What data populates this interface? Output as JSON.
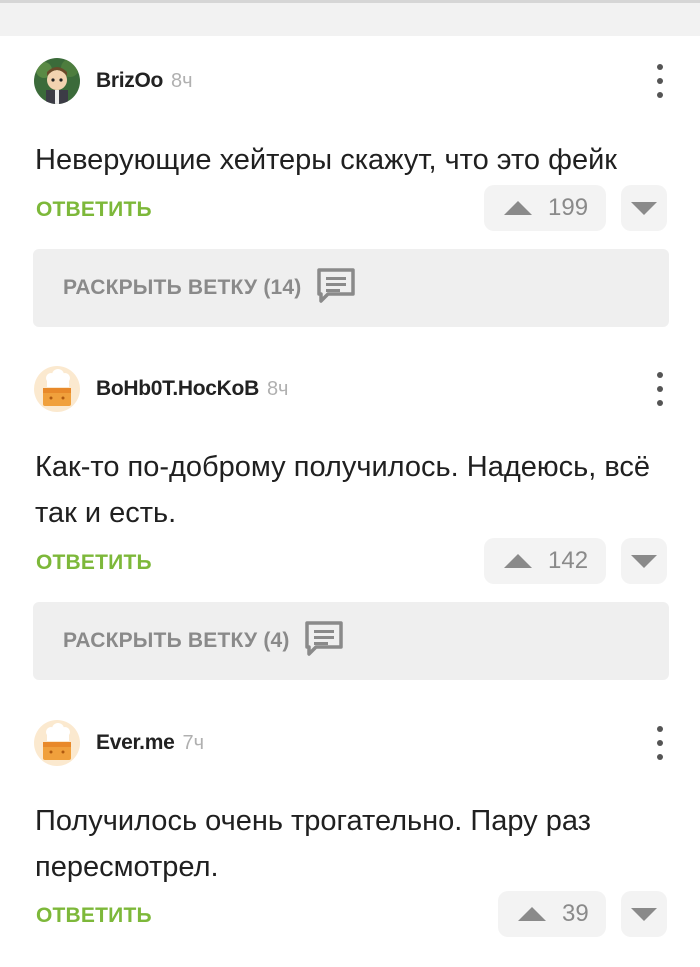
{
  "colors": {
    "accent_green": "#7db83a",
    "muted_gray": "#8a8a8a",
    "background": "#ffffff",
    "panel_gray": "#efefef"
  },
  "comments": [
    {
      "username": "BrizOo",
      "time": "8ч",
      "text": "Неверующие хейтеры скажут, что это фейк",
      "reply_label": "ОТВЕТИТЬ",
      "rating": "199",
      "expand_label": "РАСКРЫТЬ ВЕТКУ (14)",
      "avatar_icon": "cartoon-avatar-icon"
    },
    {
      "username": "BoHb0T.HocKoB",
      "time": "8ч",
      "text": "Как-то по-доброму получилось. Надеюсь, всё так и есть.",
      "reply_label": "ОТВЕТИТЬ",
      "rating": "142",
      "expand_label": "РАСКРЫТЬ ВЕТКУ (4)",
      "avatar_icon": "default-cake-avatar-icon"
    },
    {
      "username": "Ever.me",
      "time": "7ч",
      "text": "Получилось очень трогательно. Пару раз пересмотрел.",
      "reply_label": "ОТВЕТИТЬ",
      "rating": "39",
      "avatar_icon": "default-cake-avatar-icon"
    }
  ]
}
